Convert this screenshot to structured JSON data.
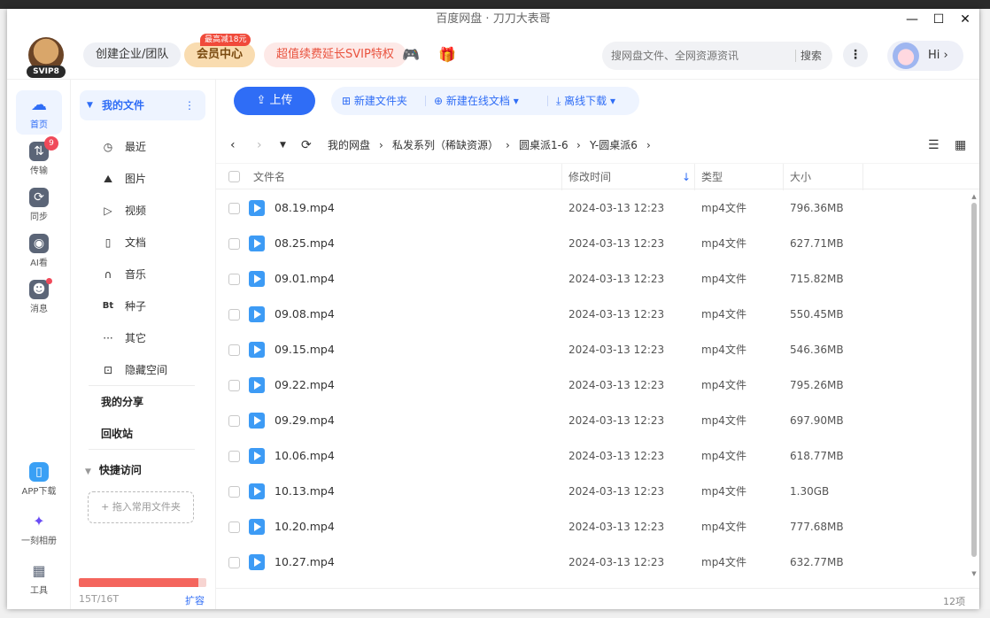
{
  "window": {
    "title": "百度网盘 · 刀刀大表哥"
  },
  "header": {
    "svip_tag": "SVIP8",
    "org_button": "创建企业/团队",
    "vip_button": "会员中心",
    "vip_badge": "最高减18元",
    "svip_promo": "超值续费延长SVIP特权",
    "game_icon": "gamepad-icon",
    "gift_icon": "gift-icon",
    "search_placeholder": "搜网盘文件、全网资源资讯",
    "search_button": "搜索",
    "hi_label": "Hi",
    "hi_chevron": "›"
  },
  "rail": {
    "home": "首页",
    "transfer": "传输",
    "transfer_badge": "9",
    "sync": "同步",
    "ai": "AI看",
    "messages": "消息",
    "app_download": "APP下载",
    "album": "一刻相册",
    "tools": "工具"
  },
  "sidebar": {
    "my_files": "我的文件",
    "items": [
      {
        "label": "最近",
        "icon": "clock-icon",
        "glyph": "◷"
      },
      {
        "label": "图片",
        "icon": "image-icon",
        "glyph": "⛰"
      },
      {
        "label": "视频",
        "icon": "play-icon",
        "glyph": "▷"
      },
      {
        "label": "文档",
        "icon": "document-icon",
        "glyph": "▯"
      },
      {
        "label": "音乐",
        "icon": "headphones-icon",
        "glyph": "∩"
      },
      {
        "label": "种子",
        "icon": "bt-icon",
        "glyph": "Bt"
      },
      {
        "label": "其它",
        "icon": "more-icon",
        "glyph": "···"
      },
      {
        "label": "隐藏空间",
        "icon": "lock-icon",
        "glyph": "⊡"
      }
    ],
    "my_share": "我的分享",
    "recycle": "回收站",
    "quick_access": "快捷访问",
    "drop_hint": "+ 拖入常用文件夹",
    "quota": "15T/16T",
    "quota_fraction": 0.9375,
    "expand": "扩容"
  },
  "toolbar": {
    "upload": "上传",
    "new_folder": "新建文件夹",
    "new_doc": "新建在线文档",
    "offline": "离线下载"
  },
  "breadcrumb": [
    "我的网盘",
    "私发系列（稀缺资源）",
    "圆桌派1-6",
    "Y-圆桌派6"
  ],
  "table": {
    "columns": {
      "name": "文件名",
      "modified": "修改时间",
      "type": "类型",
      "size": "大小"
    },
    "rows": [
      {
        "name": "08.19.mp4",
        "modified": "2024-03-13 12:23",
        "type": "mp4文件",
        "size": "796.36MB"
      },
      {
        "name": "08.25.mp4",
        "modified": "2024-03-13 12:23",
        "type": "mp4文件",
        "size": "627.71MB"
      },
      {
        "name": "09.01.mp4",
        "modified": "2024-03-13 12:23",
        "type": "mp4文件",
        "size": "715.82MB"
      },
      {
        "name": "09.08.mp4",
        "modified": "2024-03-13 12:23",
        "type": "mp4文件",
        "size": "550.45MB"
      },
      {
        "name": "09.15.mp4",
        "modified": "2024-03-13 12:23",
        "type": "mp4文件",
        "size": "546.36MB"
      },
      {
        "name": "09.22.mp4",
        "modified": "2024-03-13 12:23",
        "type": "mp4文件",
        "size": "795.26MB"
      },
      {
        "name": "09.29.mp4",
        "modified": "2024-03-13 12:23",
        "type": "mp4文件",
        "size": "697.90MB"
      },
      {
        "name": "10.06.mp4",
        "modified": "2024-03-13 12:23",
        "type": "mp4文件",
        "size": "618.77MB"
      },
      {
        "name": "10.13.mp4",
        "modified": "2024-03-13 12:23",
        "type": "mp4文件",
        "size": "1.30GB"
      },
      {
        "name": "10.20.mp4",
        "modified": "2024-03-13 12:23",
        "type": "mp4文件",
        "size": "777.68MB"
      },
      {
        "name": "10.27.mp4",
        "modified": "2024-03-13 12:23",
        "type": "mp4文件",
        "size": "632.77MB"
      }
    ]
  },
  "footer": {
    "count": "12项"
  },
  "colors": {
    "accent": "#2f6df6",
    "quota": "#f4655d",
    "vip": "#f9dcb0",
    "promo": "#e9523e"
  }
}
